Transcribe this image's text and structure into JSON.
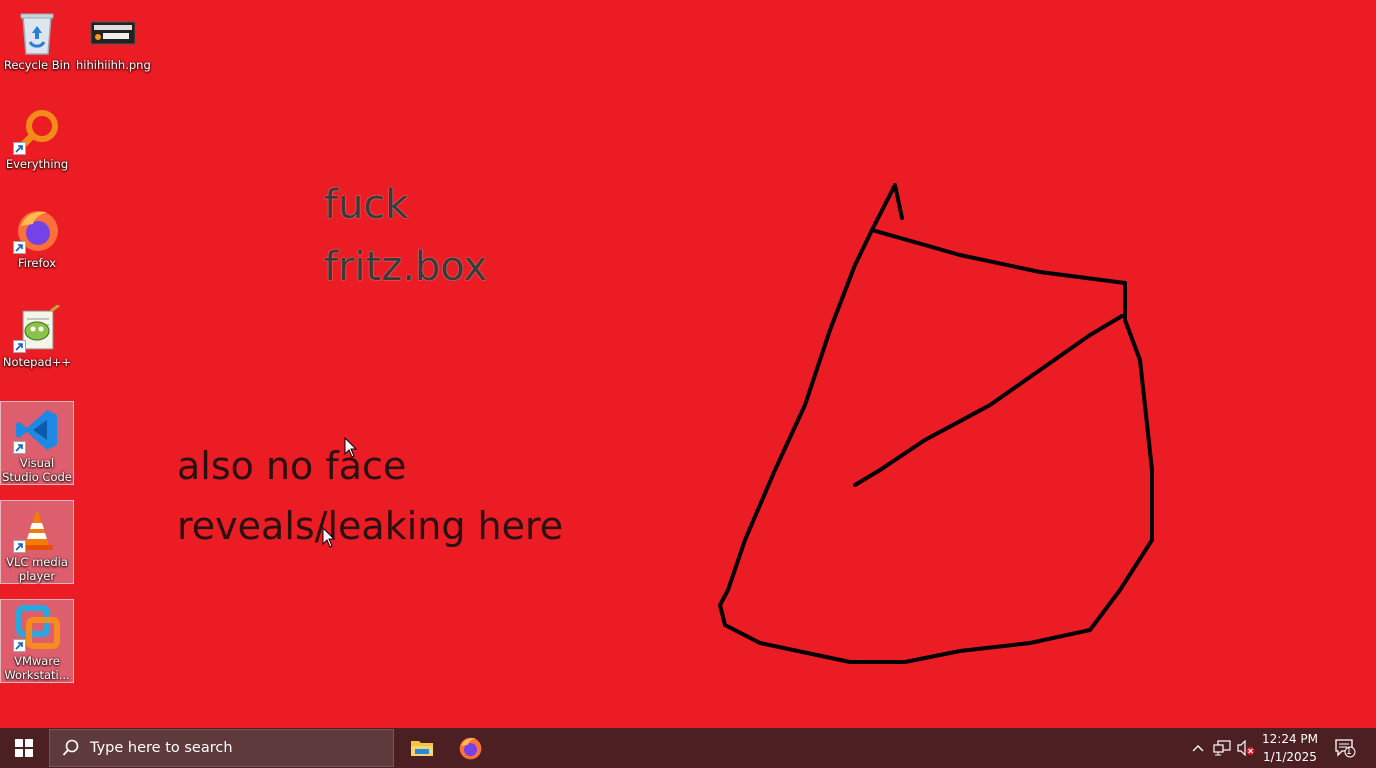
{
  "desktop": {
    "background": "#ec1c24",
    "icons": [
      {
        "label": "Recycle Bin",
        "icon": "recycle-bin-icon"
      },
      {
        "label": "hihihiihh.png",
        "icon": "image-file-icon"
      },
      {
        "label": "Everything",
        "icon": "everything-search-icon"
      },
      {
        "label": "Firefox",
        "icon": "firefox-icon"
      },
      {
        "label": "Notepad++",
        "icon": "notepad-plus-plus-icon"
      },
      {
        "label": "Visual Studio Code",
        "icon": "vscode-icon"
      },
      {
        "label": "VLC media player",
        "icon": "vlc-icon"
      },
      {
        "label": "VMware Workstati...",
        "icon": "vmware-icon"
      }
    ],
    "wallpaper_text": {
      "line1": "fuck",
      "line2": "fritz.box",
      "line3": "also no face",
      "line4": "reveals/leaking here"
    }
  },
  "taskbar": {
    "search_placeholder": "Type here to search",
    "pinned": [
      "file-explorer-icon",
      "firefox-icon"
    ],
    "tray": [
      "chevron-up-icon",
      "network-icon",
      "volume-muted-icon"
    ],
    "time": "12:24 PM",
    "date": "1/1/2025",
    "notification_count": "1",
    "color": "#4c1f22"
  }
}
